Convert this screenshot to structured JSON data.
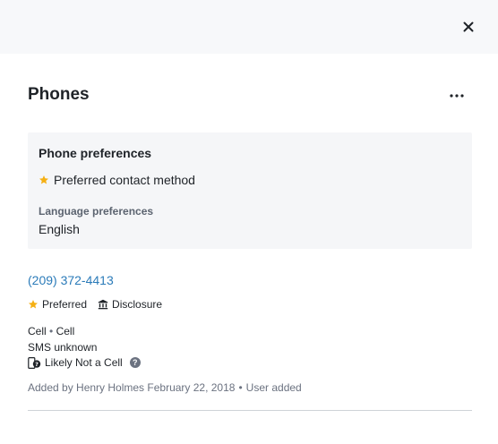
{
  "panel": {
    "title": "Phones"
  },
  "preferences": {
    "title": "Phone preferences",
    "preferred_method": "Preferred contact method",
    "language_label": "Language preferences",
    "language_value": "English"
  },
  "phone": {
    "number": "(209) 372-4413",
    "tags": {
      "preferred": "Preferred",
      "disclosure": "Disclosure"
    },
    "type_primary": "Cell",
    "type_secondary": "Cell",
    "type_separator": "•",
    "sms_status": "SMS unknown",
    "cell_likelihood": "Likely Not a Cell",
    "added_by": "Added by Henry Holmes February 22, 2018",
    "added_separator": "•",
    "source": "User added"
  },
  "colors": {
    "accent_link": "#2b7bb9",
    "star": "#f5b014",
    "card_bg": "#f5f6f8",
    "topbar_bg": "#f7f8fa"
  },
  "icons": {
    "close": "close-icon",
    "more": "more-horizontal-icon",
    "star": "star-icon",
    "disclosure": "bank-icon",
    "phone_question": "phone-question-icon",
    "help": "help-icon"
  }
}
